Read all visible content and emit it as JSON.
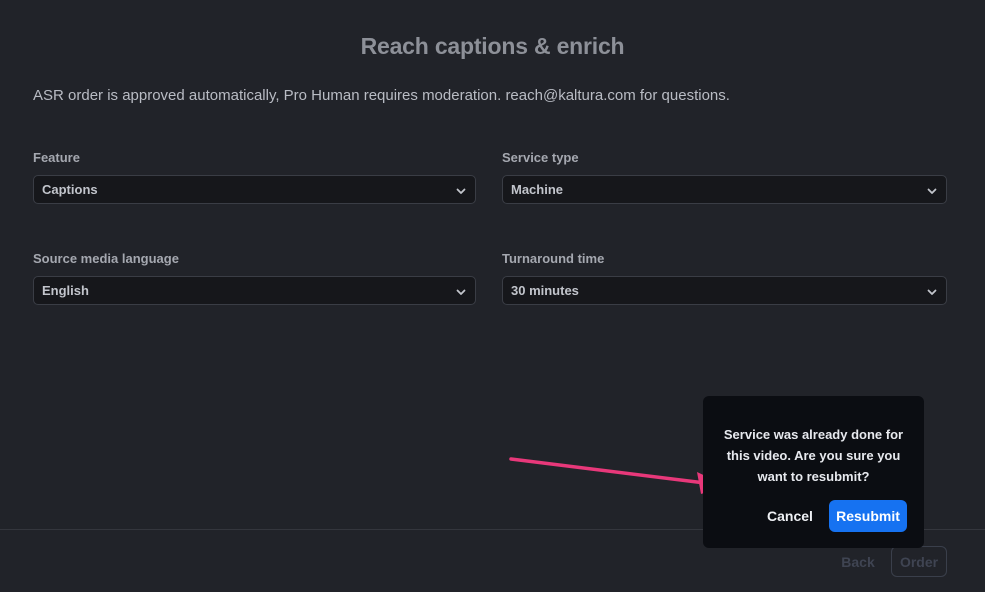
{
  "page": {
    "title": "Reach captions & enrich",
    "description": "ASR order is approved automatically, Pro Human requires moderation. reach@kaltura.com for questions."
  },
  "form": {
    "feature": {
      "label": "Feature",
      "value": "Captions"
    },
    "service_type": {
      "label": "Service type",
      "value": "Machine"
    },
    "source_language": {
      "label": "Source media language",
      "value": "English"
    },
    "turnaround": {
      "label": "Turnaround time",
      "value": "30 minutes"
    }
  },
  "footer": {
    "back_label": "Back",
    "order_label": "Order"
  },
  "popover": {
    "message": "Service was already done for this video. Are you sure you want to resubmit?",
    "cancel_label": "Cancel",
    "resubmit_label": "Resubmit"
  },
  "icons": {
    "select_chevron": "chevron-down-icon",
    "annotation_arrow": "arrow-right-icon"
  },
  "colors": {
    "background": "#212329",
    "popover_background": "#0b0d12",
    "primary_button": "#1672f1",
    "annotation_arrow": "#e8387a"
  }
}
